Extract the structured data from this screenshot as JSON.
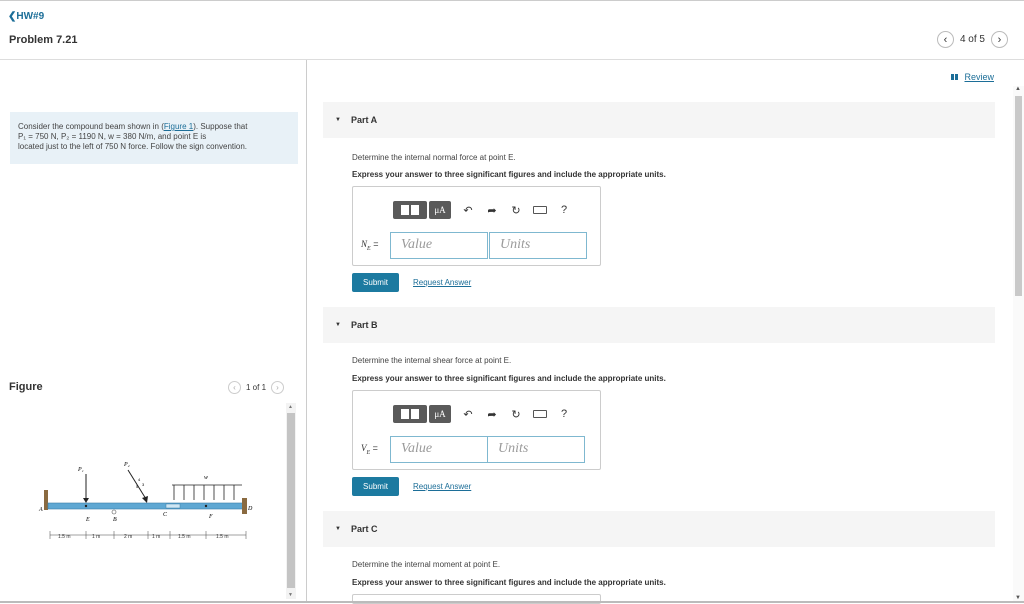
{
  "nav": {
    "back_label": "HW#9",
    "problem_title": "Problem 7.21",
    "page_indicator": "4 of 5",
    "review_label": "Review"
  },
  "intro": {
    "line1_prefix": "Consider the compound beam shown in (",
    "figure_link": "Figure 1",
    "line1_suffix": "). Suppose that",
    "line2": "P₁ = 750 N, P₂ = 1190 N, w = 380 N/m, and point E is",
    "line3": "located just to the left of 750 N force. Follow the sign convention."
  },
  "figure": {
    "label": "Figure",
    "page_indicator": "1 of 1",
    "labels": {
      "p1": "P₁",
      "p2": "P₂",
      "w": "w",
      "a": "A",
      "b": "B",
      "c": "C",
      "d": "D",
      "e": "E",
      "f": "F",
      "ratio_4": "4",
      "ratio_3": "3",
      "ratio_5": "5"
    },
    "dims": [
      "1.5 m",
      "1 m",
      "2 m",
      "1 m",
      "1.5 m",
      "1.5 m"
    ]
  },
  "parts": [
    {
      "title": "Part A",
      "question": "Determine the internal normal force at point E.",
      "instruction": "Express your answer to three significant figures and include the appropriate units.",
      "var_label": "N",
      "var_sub": "E",
      "value_placeholder": "Value",
      "units_placeholder": "Units",
      "submit_label": "Submit",
      "request_label": "Request Answer"
    },
    {
      "title": "Part B",
      "question": "Determine the internal shear force at point E.",
      "instruction": "Express your answer to three significant figures and include the appropriate units.",
      "var_label": "V",
      "var_sub": "E",
      "value_placeholder": "Value",
      "units_placeholder": "Units",
      "submit_label": "Submit",
      "request_label": "Request Answer"
    },
    {
      "title": "Part C",
      "question": "Determine the internal moment at point E.",
      "instruction": "Express your answer to three significant figures and include the appropriate units."
    }
  ],
  "toolbar": {
    "mu_label": "μA",
    "help_label": "?"
  },
  "colors": {
    "accent": "#1c7aa0",
    "link": "#1c6e98",
    "part_bg": "#f5f5f5",
    "intro_bg": "#e8f1f7",
    "beam": "#5fa8d3"
  }
}
